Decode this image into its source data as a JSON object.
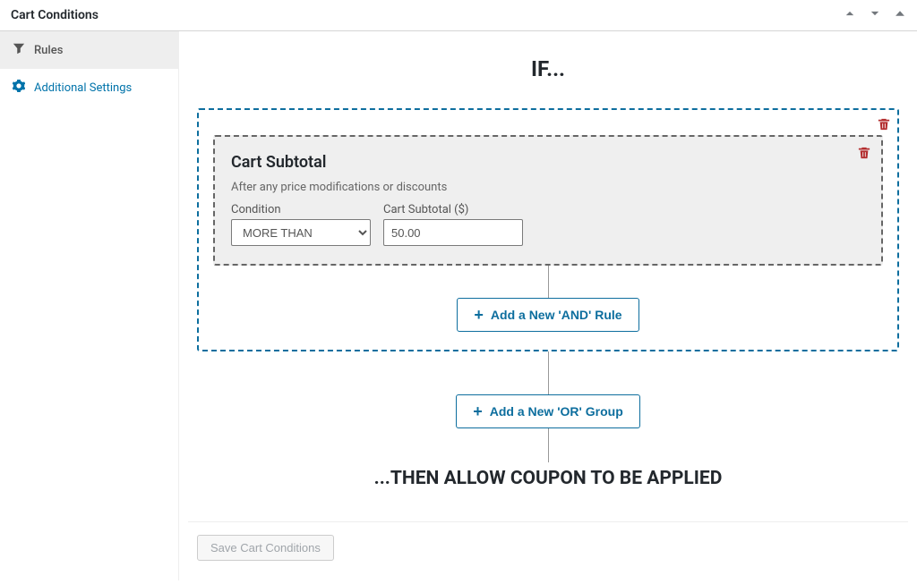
{
  "panel": {
    "title": "Cart Conditions"
  },
  "sidebar": {
    "items": [
      {
        "label": "Rules"
      },
      {
        "label": "Additional Settings"
      }
    ]
  },
  "rules": {
    "if_label": "IF...",
    "then_label": "...THEN ALLOW COUPON TO BE APPLIED",
    "add_and_label": "Add a New 'AND' Rule",
    "add_or_label": "Add a New 'OR' Group",
    "rule": {
      "title": "Cart Subtotal",
      "desc": "After any price modifications or discounts",
      "condition_label": "Condition",
      "condition_value": "MORE THAN",
      "value_label": "Cart Subtotal ($)",
      "value": "50.00"
    }
  },
  "footer": {
    "save_label": "Save Cart Conditions"
  }
}
